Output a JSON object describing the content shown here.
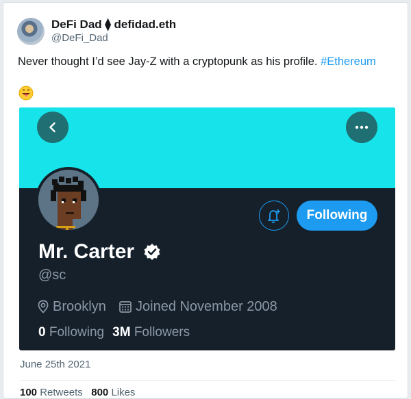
{
  "tweet": {
    "author": {
      "display_name": "DeFi Dad ⧫ defidad.eth",
      "handle": "@DeFi_Dad"
    },
    "text": "Never thought I’d see Jay-Z with a cryptopunk as his profile.",
    "hashtag": "#Ethereum",
    "emoji": "grinning-tongue-emoji",
    "date": "June 25th 2021",
    "bottom_stats": {
      "retweets_count": "100",
      "retweets_label": "Retweets",
      "likes_count": "800",
      "likes_label": "Likes"
    }
  },
  "embedded_profile": {
    "banner_color": "#16e4ea",
    "back_icon": "chevron-left-icon",
    "more_icon": "more-horizontal-icon",
    "notify_icon": "bell-plus-icon",
    "following_button": "Following",
    "name": "Mr. Carter",
    "verified_icon": "verified-badge-icon",
    "handle": "@sc",
    "location": "Brooklyn",
    "joined": "Joined November 2008",
    "following_count": "0",
    "following_label": "Following",
    "followers_count": "3M",
    "followers_label": "Followers"
  },
  "colors": {
    "accent": "#1d9bf0",
    "dark_bg": "#15202b",
    "muted_text": "#8b98a5"
  }
}
